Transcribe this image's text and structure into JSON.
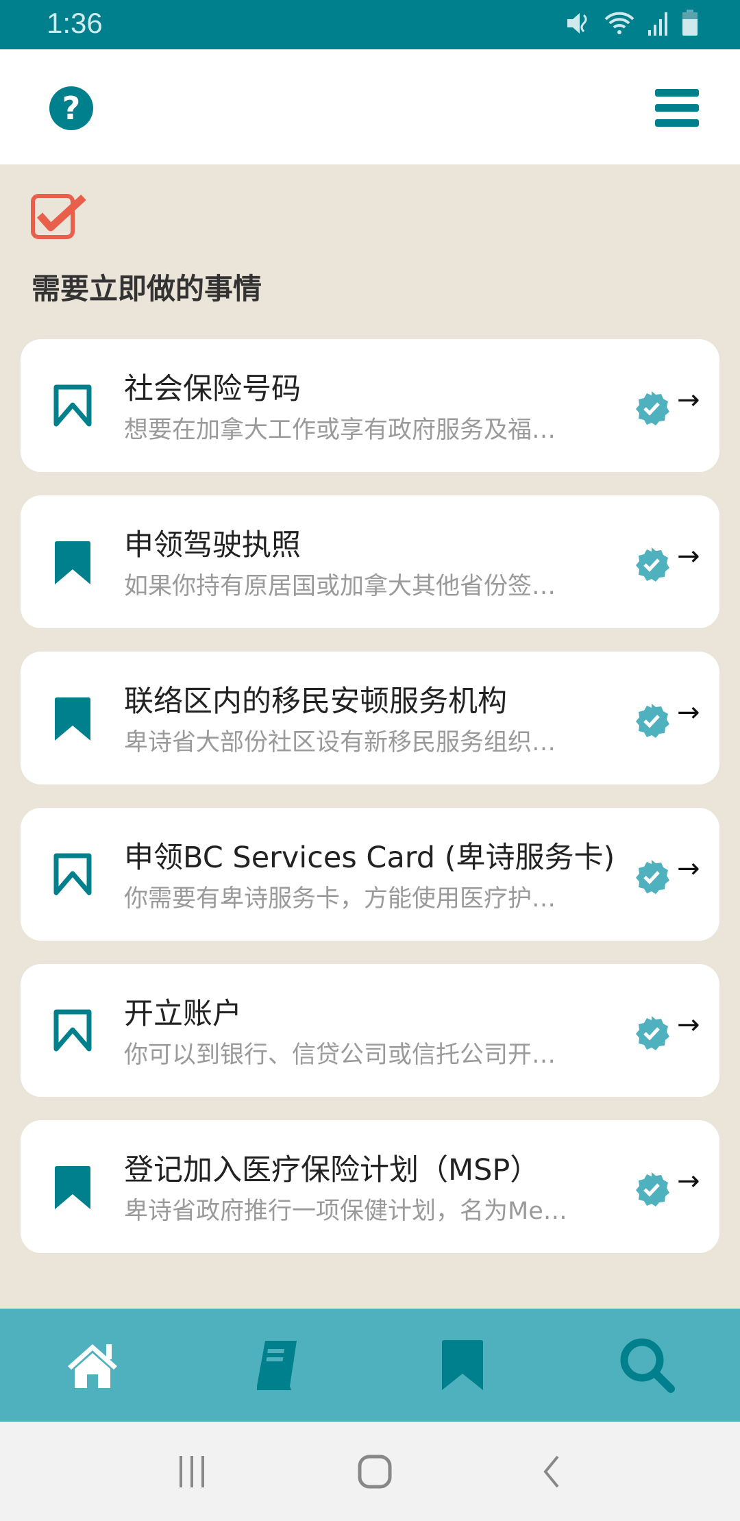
{
  "status_bar": {
    "time": "1:36",
    "icons": [
      "mute-icon",
      "wifi-icon",
      "signal-icon",
      "battery-icon"
    ]
  },
  "header": {
    "help_icon": "question-circle-icon",
    "menu_icon": "hamburger-icon"
  },
  "section": {
    "icon": "checkbox-checked-icon",
    "title": "需要立即做的事情"
  },
  "colors": {
    "primary": "#00808c",
    "nav": "#4fb1be",
    "accent": "#e8604c",
    "background": "#ebe4d8",
    "badge": "#4fb1be"
  },
  "tasks": [
    {
      "title": "社会保险号码",
      "subtitle": "想要在加拿大工作或享有政府服务及福…",
      "bookmarked": false,
      "verified": true
    },
    {
      "title": "申领驾驶执照",
      "subtitle": " 如果你持有原居国或加拿大其他省份签…",
      "bookmarked": true,
      "verified": true
    },
    {
      "title": "联络区内的移民安顿服务机构",
      "subtitle": "卑诗省大部份社区设有新移民服务组织…",
      "bookmarked": true,
      "verified": true
    },
    {
      "title": "申领BC Services Card (卑诗服务卡)",
      "subtitle": "你需要有卑诗服务卡，方能使用医疗护…",
      "bookmarked": false,
      "verified": true
    },
    {
      "title": "开立账户",
      "subtitle": "你可以到银行、信贷公司或信托公司开…",
      "bookmarked": false,
      "verified": true
    },
    {
      "title": "登记加入医疗保险计划（MSP）",
      "subtitle": "卑诗省政府推行一项保健计划，名为Me…",
      "bookmarked": true,
      "verified": true
    }
  ],
  "bottom_nav": [
    {
      "icon": "home-icon",
      "active": true
    },
    {
      "icon": "book-icon"
    },
    {
      "icon": "bookmark-icon"
    },
    {
      "icon": "search-icon"
    }
  ],
  "system_nav": [
    "recents-icon",
    "home-icon",
    "back-icon"
  ]
}
